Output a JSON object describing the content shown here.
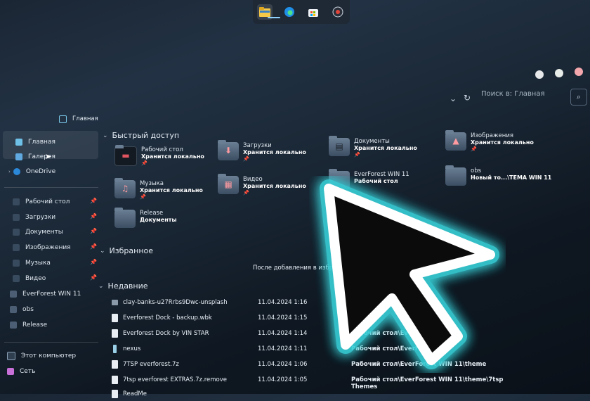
{
  "taskbar": {
    "apps": [
      {
        "name": "file-explorer-icon",
        "glyph": "🗂"
      },
      {
        "name": "edge-icon",
        "glyph": "◎"
      },
      {
        "name": "store-icon",
        "glyph": "▦"
      },
      {
        "name": "screenshot-icon",
        "glyph": "⦿"
      }
    ]
  },
  "window": {
    "breadcrumb": "Главная",
    "search_placeholder": "Поиск в: Главная"
  },
  "sidebar": {
    "items": [
      {
        "label": "Главная"
      },
      {
        "label": "Галерея"
      },
      {
        "label": "OneDrive"
      },
      {
        "label": "Рабочий стол"
      },
      {
        "label": "Загрузки"
      },
      {
        "label": "Документы"
      },
      {
        "label": "Изображения"
      },
      {
        "label": "Музыка"
      },
      {
        "label": "Видео"
      },
      {
        "label": "EverForest WIN 11"
      },
      {
        "label": "obs"
      },
      {
        "label": "Release"
      },
      {
        "label": "Этот компьютер"
      },
      {
        "label": "Сеть"
      }
    ]
  },
  "sections": {
    "quick_access": "Быстрый доступ",
    "favorites": "Избранное",
    "recent": "Недавние"
  },
  "quick_access": [
    {
      "name": "Рабочий стол",
      "sub": "Хранится локально"
    },
    {
      "name": "Загрузки",
      "sub": "Хранится локально"
    },
    {
      "name": "Документы",
      "sub": "Хранится локально"
    },
    {
      "name": "Изображения",
      "sub": "Хранится локально"
    },
    {
      "name": "Музыка",
      "sub": "Хранится локально"
    },
    {
      "name": "Видео",
      "sub": "Хранится локально"
    },
    {
      "name": "EverForest WIN 11",
      "sub": "Рабочий стол"
    },
    {
      "name": "obs",
      "sub": "Новый то...\\TEMA WIN 11"
    },
    {
      "name": "Release",
      "sub": "Документы"
    }
  ],
  "favorites_empty": "После добавления в избранное",
  "recent": [
    {
      "name": "clay-banks-u27Rrbs9Dwc-unsplash",
      "date": "11.04.2024 1:16",
      "path": ""
    },
    {
      "name": "Everforest Dock - backup.wbk",
      "date": "11.04.2024 1:15",
      "path": ""
    },
    {
      "name": "Everforest Dock by VIN STAR",
      "date": "11.04.2024 1:14",
      "path": "Рабочий стол\\EverForest"
    },
    {
      "name": "nexus",
      "date": "11.04.2024 1:11",
      "path": "Рабочий стол\\EverForest"
    },
    {
      "name": "7TSP everforest.7z",
      "date": "11.04.2024 1:06",
      "path": "Рабочий стол\\EverForest WIN 11\\theme"
    },
    {
      "name": "7tsp everforest EXTRAS.7z.remove",
      "date": "11.04.2024 1:05",
      "path": "Рабочий стол\\EverForest WIN 11\\theme\\7tsp Themes"
    },
    {
      "name": "ReadMe",
      "date": "",
      "path": ""
    }
  ],
  "colors": {
    "accent": "#39d0d8",
    "cursor_fill": "#0b0b0b",
    "cursor_outline": "#ffffff"
  }
}
